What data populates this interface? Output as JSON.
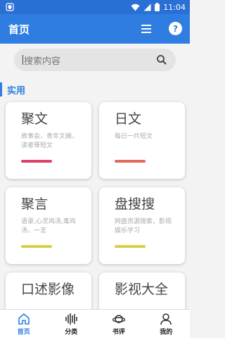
{
  "status_bar": {
    "time": "11:04"
  },
  "app_bar": {
    "title": "首页",
    "help_glyph": "?"
  },
  "search": {
    "placeholder": "搜索内容"
  },
  "section": {
    "label": "实用"
  },
  "cards": [
    {
      "title": "聚文",
      "desc": "故事会，青年文摘，读者等短文",
      "accent": "#d9436b"
    },
    {
      "title": "日文",
      "desc": "每日一片短文",
      "accent": "#e06b5a"
    },
    {
      "title": "聚言",
      "desc": "语录,心灵鸡汤,毒鸡汤，一言",
      "accent": "#d7cf4a"
    },
    {
      "title": "盘搜搜",
      "desc": "网盘资源搜索，影视娱乐学习",
      "accent": "#d7cf4a"
    },
    {
      "title": "口述影像",
      "desc": "",
      "accent": ""
    },
    {
      "title": "影视大全",
      "desc": "",
      "accent": ""
    }
  ],
  "bottom_nav": [
    {
      "label": "首页",
      "icon": "home-icon",
      "active": true
    },
    {
      "label": "分类",
      "icon": "category-icon",
      "active": false
    },
    {
      "label": "书评",
      "icon": "planet-icon",
      "active": false
    },
    {
      "label": "我的",
      "icon": "user-icon",
      "active": false
    }
  ],
  "colors": {
    "primary": "#2f7de1",
    "status_bar": "#2a6fd4"
  }
}
